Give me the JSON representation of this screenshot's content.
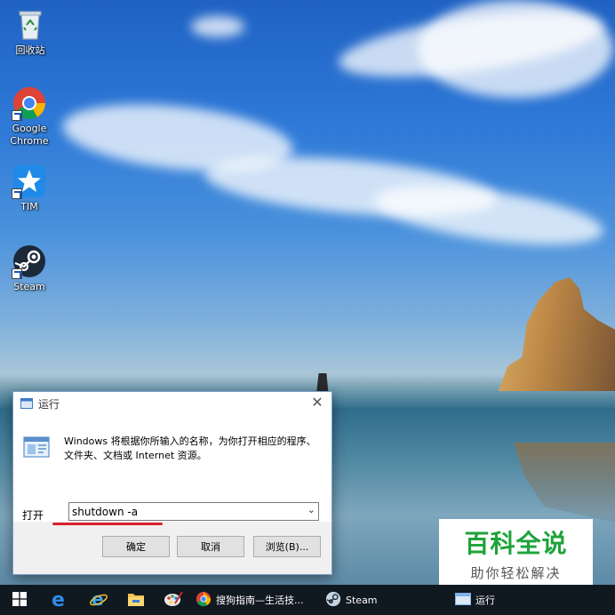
{
  "desktop": {
    "icons": [
      {
        "label": "回收站",
        "icon": "recycle-bin-icon"
      },
      {
        "label": "Google\nChrome",
        "icon": "chrome-icon"
      },
      {
        "label": "TIM",
        "icon": "tim-icon"
      },
      {
        "label": "Steam",
        "icon": "steam-icon"
      }
    ]
  },
  "run_dialog": {
    "title": "运行",
    "close_glyph": "✕",
    "description": "Windows 将根据你所输入的名称，为你打开相应的程序、文件夹、文档或 Internet 资源。",
    "open_label": "打开",
    "command_value": "shutdown -a",
    "ok_label": "确定",
    "cancel_label": "取消",
    "browse_label": "浏览(B)..."
  },
  "watermark": {
    "title": "百科全说",
    "subtitle": "助你轻松解决"
  },
  "taskbar": {
    "items": [
      {
        "icon": "windows-start-icon"
      },
      {
        "icon": "edge-icon"
      },
      {
        "icon": "internet-explorer-icon"
      },
      {
        "icon": "file-explorer-icon"
      },
      {
        "icon": "paint-icon"
      },
      {
        "icon": "chrome-icon",
        "label": "搜狗指南—生活技..."
      },
      {
        "icon": "steam-icon",
        "label": "Steam"
      },
      {
        "icon": "run-icon",
        "label": "运行"
      }
    ]
  },
  "colors": {
    "accent_underline": "#d8202e",
    "watermark_green": "#1ea33a",
    "taskbar_bg": "#101820"
  }
}
